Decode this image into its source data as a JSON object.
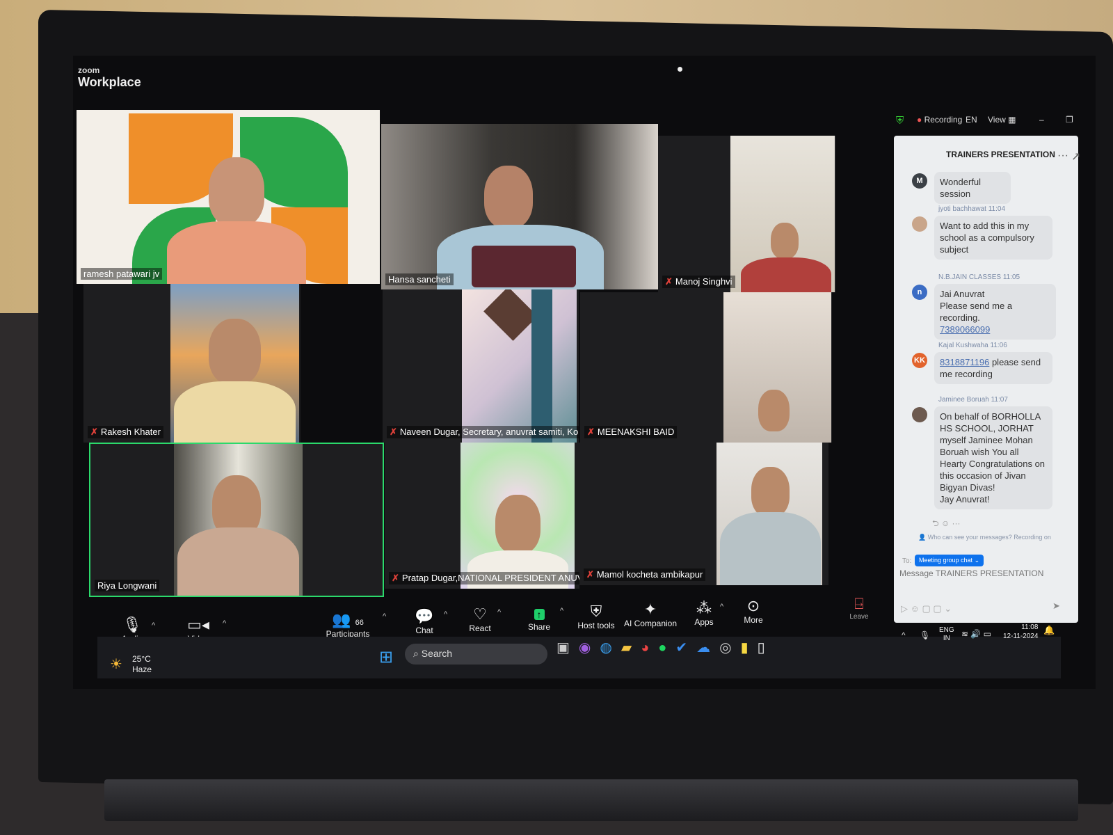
{
  "app": {
    "logo_small": "zoom",
    "logo_big": "Workplace"
  },
  "top_bar": {
    "recording": "Recording",
    "language": "EN",
    "view": "View"
  },
  "participants": [
    {
      "name": "ramesh patawari jv",
      "muted": false
    },
    {
      "name": "Hansa sancheti",
      "muted": false
    },
    {
      "name": "Manoj Singhvi",
      "muted": true
    },
    {
      "name": "Rakesh Khater",
      "muted": true
    },
    {
      "name": "Naveen Dugar, Secretary, anuvrat samiti, Kolkata",
      "muted": true
    },
    {
      "name": "MEENAKSHI BAID",
      "muted": true
    },
    {
      "name": "Riya Longwani",
      "muted": false,
      "active_speaker": true
    },
    {
      "name": "Pratap Dugar,NATIONAL PRESIDENT ANUVIBHA",
      "muted": true
    },
    {
      "name": "Mamol kocheta ambikapur",
      "muted": true
    }
  ],
  "chat": {
    "title": "TRAINERS PRESENTATION",
    "messages": [
      {
        "avatar": "M",
        "sender": "",
        "time": "",
        "text": "Wonderful session"
      },
      {
        "avatar": "",
        "sender": "jyoti bachhawat",
        "time": "11:04",
        "text": "Want to add this in my school as a compulsory subject"
      },
      {
        "avatar": "n",
        "sender": "N.B.JAIN CLASSES",
        "time": "11:05",
        "text": "Jai Anuvrat",
        "text2": "Please send me a recording.",
        "link": "7389066099"
      },
      {
        "avatar": "KK",
        "sender": "Kajal Kushwaha",
        "time": "11:06",
        "link": "8318871196",
        "text": " please send me recording"
      },
      {
        "avatar": "",
        "sender": "Jaminee Boruah",
        "time": "11:07",
        "text": "On behalf of BORHOLLA HS SCHOOL, JORHAT  myself Jaminee Mohan Boruah wish You all  Hearty Congratulations on this occasion of Jivan Bigyan Divas!",
        "text2": "Jay Anuvrat!"
      }
    ],
    "notice": "Who can see your messages? Recording on",
    "to_label": "To:",
    "recipient": "Meeting group chat",
    "placeholder": "Message TRAINERS PRESENTATION"
  },
  "toolbar": {
    "audio": "Audio",
    "video": "Video",
    "participants": "Participants",
    "participant_count": "66",
    "chat": "Chat",
    "react": "React",
    "share": "Share",
    "host_tools": "Host tools",
    "ai_companion": "AI Companion",
    "apps": "Apps",
    "more": "More",
    "leave": "Leave"
  },
  "taskbar": {
    "temp": "25°C",
    "weather": "Haze",
    "search": "Search",
    "lang": "ENG",
    "region": "IN",
    "time": "11:08",
    "date": "12-11-2024"
  },
  "colors": {
    "active_speaker": "#2bd96b",
    "share": "#1fcf6a",
    "recipient": "#0e72ed",
    "mute": "#e0413a"
  }
}
